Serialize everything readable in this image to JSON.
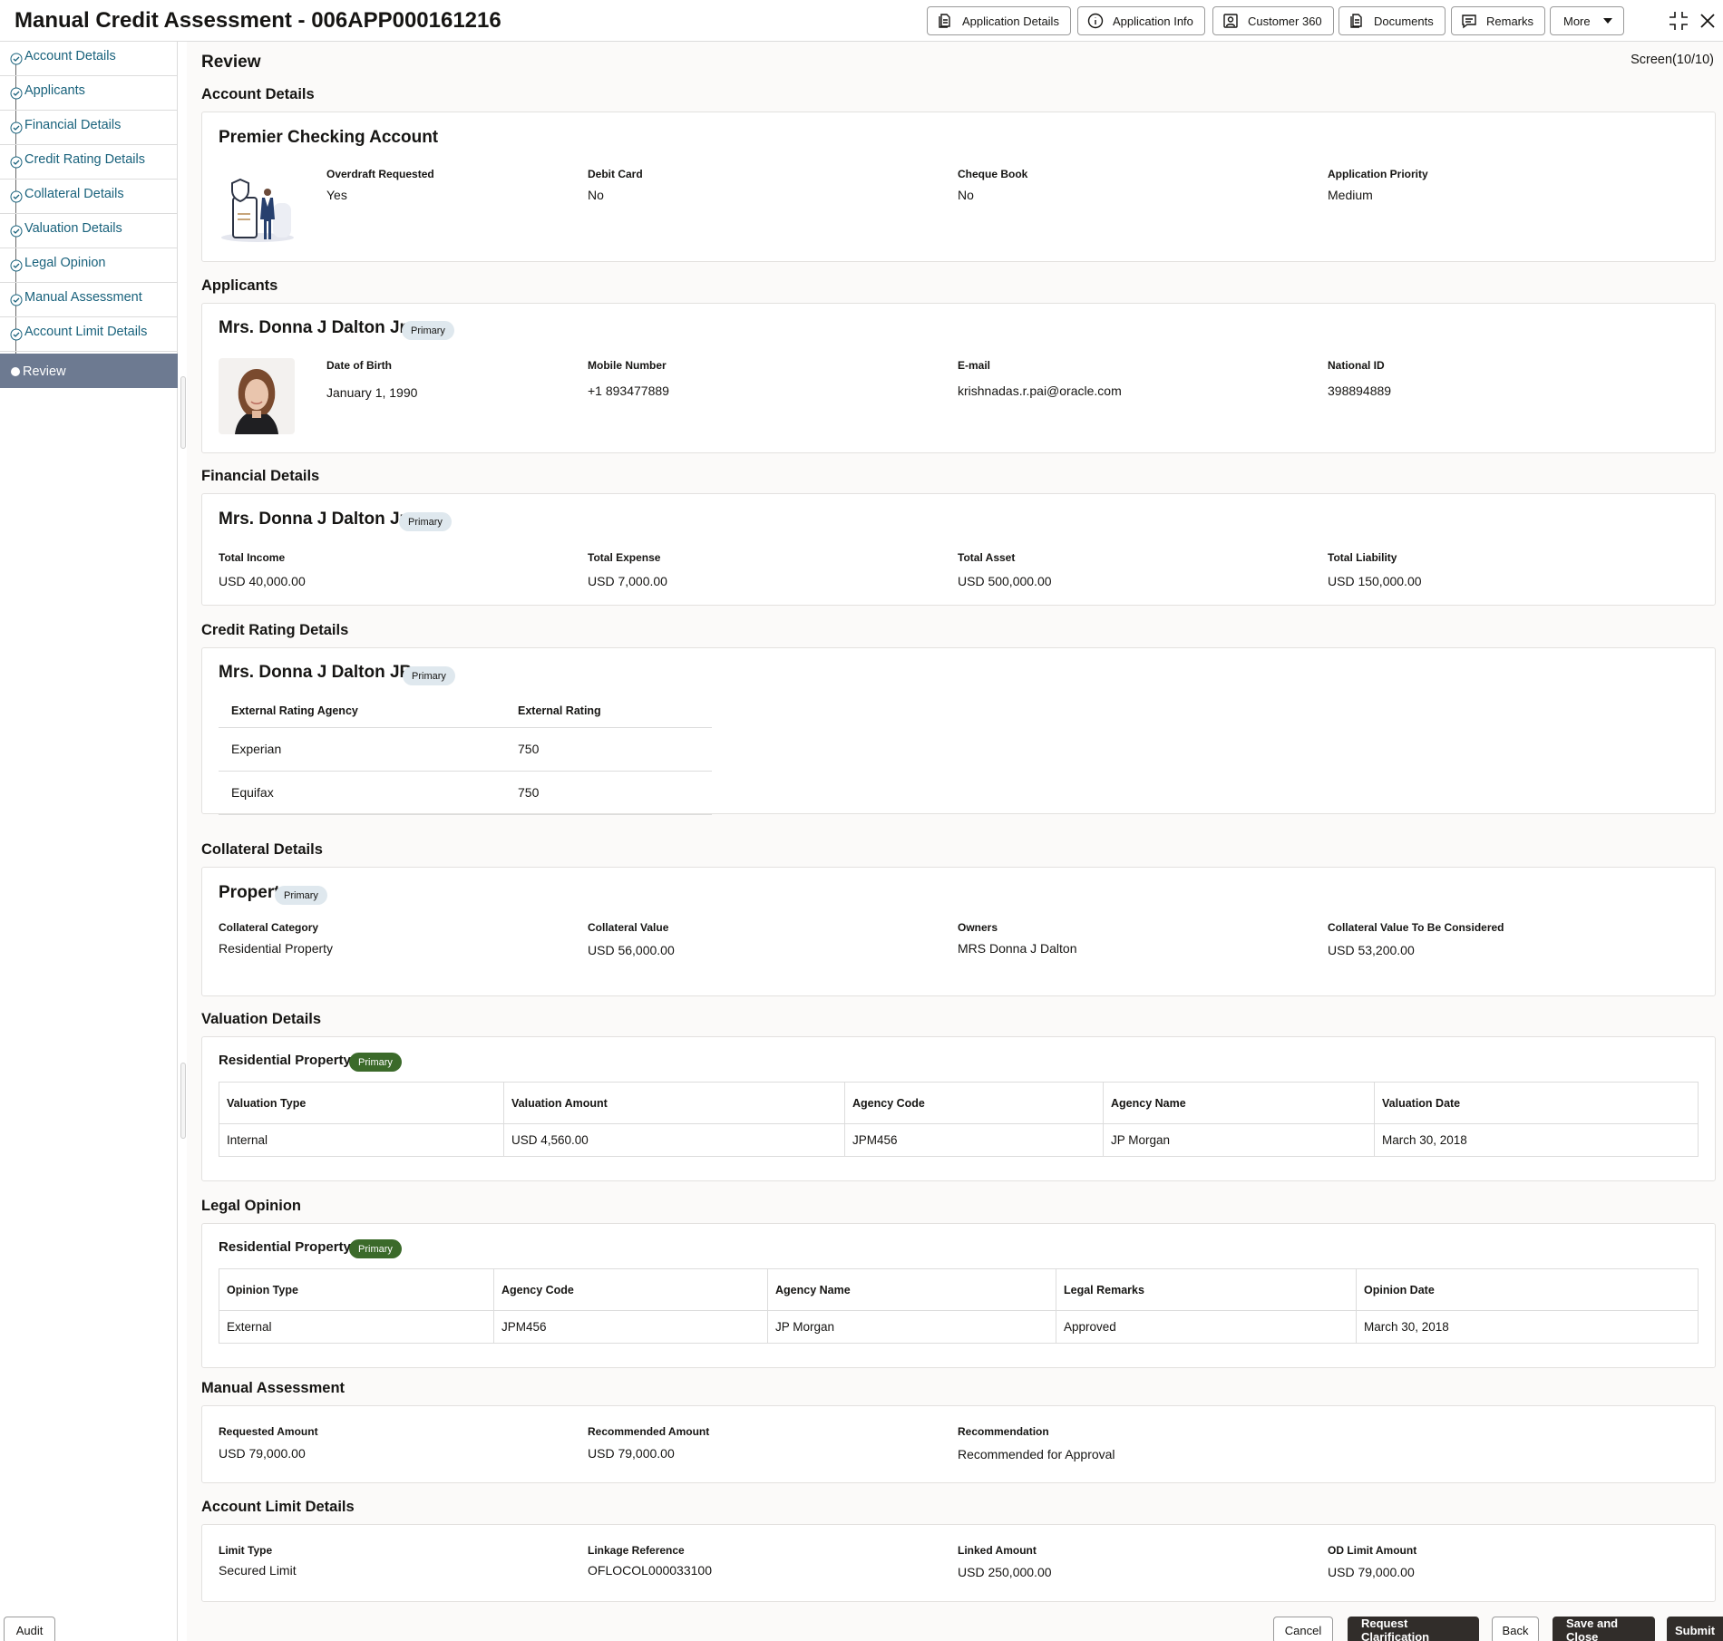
{
  "header": {
    "title": "Manual Credit Assessment - 006APP000161216",
    "buttons": [
      {
        "label": "Application Details",
        "icon": "document-icon"
      },
      {
        "label": "Application Info",
        "icon": "info-icon"
      },
      {
        "label": "Customer 360",
        "icon": "person-card-icon"
      },
      {
        "label": "Documents",
        "icon": "documents-icon"
      },
      {
        "label": "Remarks",
        "icon": "comment-icon"
      }
    ],
    "more_label": "More"
  },
  "sidebar": {
    "items": [
      {
        "label": "Account Details",
        "state": "completed"
      },
      {
        "label": "Applicants",
        "state": "completed"
      },
      {
        "label": "Financial Details",
        "state": "completed"
      },
      {
        "label": "Credit Rating Details",
        "state": "completed"
      },
      {
        "label": "Collateral Details",
        "state": "completed"
      },
      {
        "label": "Valuation Details",
        "state": "completed"
      },
      {
        "label": "Legal Opinion",
        "state": "completed"
      },
      {
        "label": "Manual Assessment",
        "state": "completed"
      },
      {
        "label": "Account Limit Details",
        "state": "completed"
      },
      {
        "label": "Review",
        "state": "active"
      }
    ],
    "audit_label": "Audit"
  },
  "main": {
    "title": "Review",
    "screen": "Screen(10/10)"
  },
  "account_details": {
    "section": "Account Details",
    "product": "Premier Checking Account",
    "fields": [
      {
        "label": "Overdraft Requested",
        "value": "Yes"
      },
      {
        "label": "Debit Card",
        "value": "No"
      },
      {
        "label": "Cheque Book",
        "value": "No"
      },
      {
        "label": "Application Priority",
        "value": "Medium"
      }
    ]
  },
  "applicants": {
    "section": "Applicants",
    "name": "Mrs. Donna J Dalton Jr.",
    "badge": "Primary",
    "fields": [
      {
        "label": "Date of Birth",
        "value": "January 1, 1990"
      },
      {
        "label": "Mobile Number",
        "value": "+1 893477889"
      },
      {
        "label": "E-mail",
        "value": "krishnadas.r.pai@oracle.com"
      },
      {
        "label": "National ID",
        "value": "398894889"
      }
    ]
  },
  "financial_details": {
    "section": "Financial Details",
    "name": "Mrs. Donna J Dalton Jr.",
    "badge": "Primary",
    "fields": [
      {
        "label": "Total Income",
        "value": "USD 40,000.00"
      },
      {
        "label": "Total Expense",
        "value": "USD 7,000.00"
      },
      {
        "label": "Total Asset",
        "value": "USD 500,000.00"
      },
      {
        "label": "Total Liability",
        "value": "USD 150,000.00"
      }
    ]
  },
  "credit_rating": {
    "section": "Credit Rating Details",
    "name": "Mrs. Donna J Dalton JR",
    "badge": "Primary",
    "columns": [
      "External Rating Agency",
      "External Rating"
    ],
    "rows": [
      [
        "Experian",
        "750"
      ],
      [
        "Equifax",
        "750"
      ]
    ]
  },
  "collateral_details": {
    "section": "Collateral Details",
    "name": "Property",
    "badge": "Primary",
    "fields": [
      {
        "label": "Collateral Category",
        "value": "Residential Property"
      },
      {
        "label": "Collateral Value",
        "value": "USD 56,000.00"
      },
      {
        "label": "Owners",
        "value": "MRS Donna J Dalton"
      },
      {
        "label": "Collateral Value To Be Considered",
        "value": "USD 53,200.00"
      }
    ]
  },
  "valuation_details": {
    "section": "Valuation Details",
    "name": "Residential Property",
    "badge": "Primary",
    "columns": [
      "Valuation Type",
      "Valuation Amount",
      "Agency Code",
      "Agency Name",
      "Valuation Date"
    ],
    "rows": [
      [
        "Internal",
        "USD 4,560.00",
        "JPM456",
        "JP Morgan",
        "March 30, 2018"
      ]
    ]
  },
  "legal_opinion": {
    "section": "Legal Opinion",
    "name": "Residential Property",
    "badge": "Primary",
    "columns": [
      "Opinion Type",
      "Agency Code",
      "Agency Name",
      "Legal Remarks",
      "Opinion Date"
    ],
    "rows": [
      [
        "External",
        "JPM456",
        "JP Morgan",
        "Approved",
        "March 30, 2018"
      ]
    ]
  },
  "manual_assessment": {
    "section": "Manual Assessment",
    "fields": [
      {
        "label": "Requested Amount",
        "value": "USD 79,000.00"
      },
      {
        "label": "Recommended Amount",
        "value": "USD 79,000.00"
      },
      {
        "label": "Recommendation",
        "value": "Recommended for Approval"
      }
    ]
  },
  "account_limit_details": {
    "section": "Account Limit Details",
    "fields": [
      {
        "label": "Limit Type",
        "value": "Secured Limit"
      },
      {
        "label": "Linkage Reference",
        "value": "OFLOCOL000033100"
      },
      {
        "label": "Linked Amount",
        "value": "USD 250,000.00"
      },
      {
        "label": "OD Limit Amount",
        "value": "USD 79,000.00"
      }
    ]
  },
  "footer": {
    "cancel": "Cancel",
    "request_clarification": "Request Clarification",
    "back": "Back",
    "save_close": "Save and Close",
    "submit": "Submit"
  }
}
